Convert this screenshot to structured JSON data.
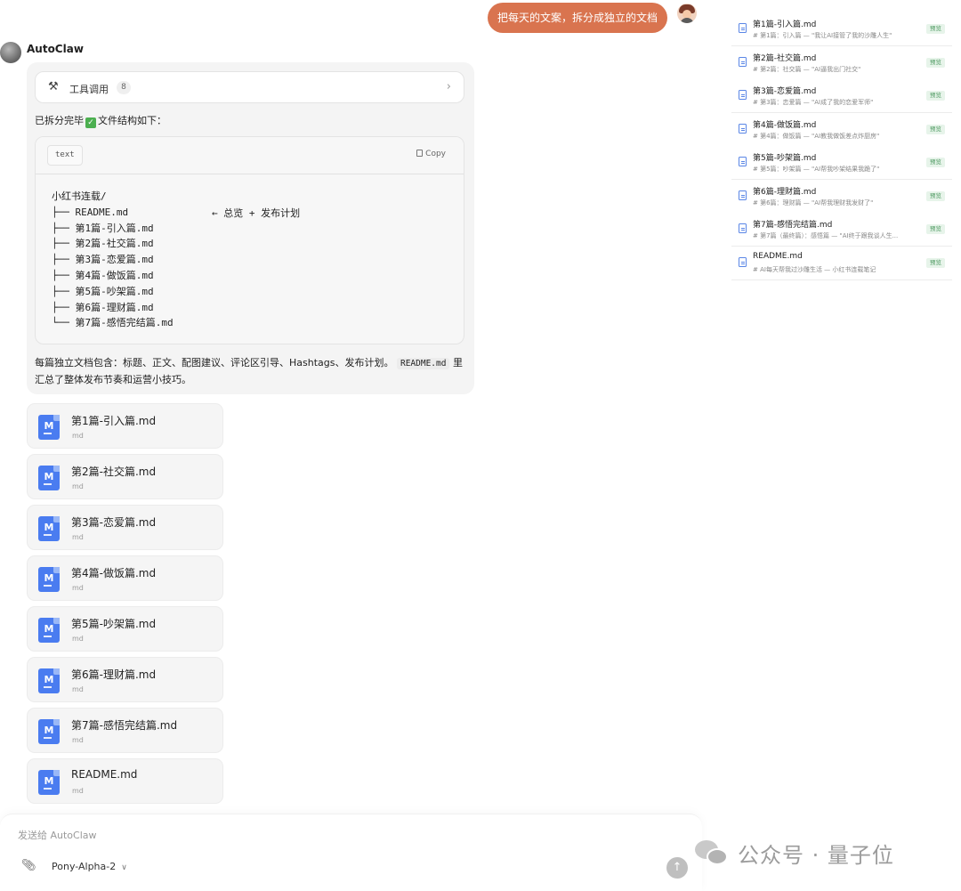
{
  "user_message": "把每天的文案，拆分成独立的文档",
  "assistant": {
    "name": "AutoClaw",
    "tool_call": {
      "label": "工具调用",
      "count": "8"
    },
    "intro_before": "已拆分完毕",
    "intro_after": "文件结构如下：",
    "code_block": {
      "lang": "text",
      "copy_label": "Copy",
      "lines": [
        "小红书连载/",
        "├── README.md",
        "├── 第1篇-引入篇.md",
        "├── 第2篇-社交篇.md",
        "├── 第3篇-恋爱篇.md",
        "├── 第4篇-做饭篇.md",
        "├── 第5篇-吵架篇.md",
        "├── 第6篇-理财篇.md",
        "└── 第7篇-感悟完结篇.md"
      ],
      "note": "← 总览 + 发布计划"
    },
    "summary_before": "每篇独立文档包含：标题、正文、配图建议、评论区引导、Hashtags、发布计划。",
    "summary_code": "README.md",
    "summary_after": " 里汇总了整体发布节奏和运营小技巧。",
    "attachments": [
      {
        "name": "第1篇-引入篇.md",
        "ext": "md"
      },
      {
        "name": "第2篇-社交篇.md",
        "ext": "md"
      },
      {
        "name": "第3篇-恋爱篇.md",
        "ext": "md"
      },
      {
        "name": "第4篇-做饭篇.md",
        "ext": "md"
      },
      {
        "name": "第5篇-吵架篇.md",
        "ext": "md"
      },
      {
        "name": "第6篇-理财篇.md",
        "ext": "md"
      },
      {
        "name": "第7篇-感悟完结篇.md",
        "ext": "md"
      },
      {
        "name": "README.md",
        "ext": "md"
      }
    ]
  },
  "composer": {
    "placeholder": "发送给 AutoClaw",
    "model": "Pony-Alpha-2"
  },
  "watermark": "公众号 · 量子位",
  "side_panel": {
    "items": [
      {
        "name": "第1篇-引入篇.md",
        "desc": "# 第1篇：引入篇 — \"我让AI接管了我的沙雕人生\"",
        "tag": "预览"
      },
      {
        "name": "第2篇-社交篇.md",
        "desc": "# 第2篇：社交篇 — \"AI逼我出门社交\"",
        "tag": "预览"
      },
      {
        "name": "第3篇-恋爱篇.md",
        "desc": "# 第3篇：恋爱篇 — \"AI成了我的恋爱军师\"",
        "tag": "预览"
      },
      {
        "name": "第4篇-做饭篇.md",
        "desc": "# 第4篇：做饭篇 — \"AI教我做饭差点炸厨房\"",
        "tag": "预览"
      },
      {
        "name": "第5篇-吵架篇.md",
        "desc": "# 第5篇：吵架篇 — \"AI帮我吵架结果我跪了\"",
        "tag": "预览"
      },
      {
        "name": "第6篇-理财篇.md",
        "desc": "# 第6篇：理财篇 — \"AI帮我理财我发财了\"",
        "tag": "预览"
      },
      {
        "name": "第7篇-感悟完结篇.md",
        "desc": "# 第7篇（最终篇）：感悟篇 — \"AI终于跟我谈人生...",
        "tag": "预览"
      },
      {
        "name": "README.md",
        "desc": "# AI每天帮我过沙雕生活 — 小红书连载笔记",
        "tag": "预览"
      }
    ]
  },
  "colors": {
    "user_bubble": "#d9744f",
    "file_icon": "#4a7cf0",
    "preview_tag_bg": "#e7f4ea",
    "preview_tag_text": "#4f9a62"
  },
  "icons": {
    "tool": "wrench-icon",
    "chevron": "chevron-right-icon",
    "check": "check-emoji-icon",
    "copy": "copy-icon",
    "file": "markdown-file-icon",
    "attach": "paperclip-icon",
    "send": "arrow-up-icon"
  }
}
